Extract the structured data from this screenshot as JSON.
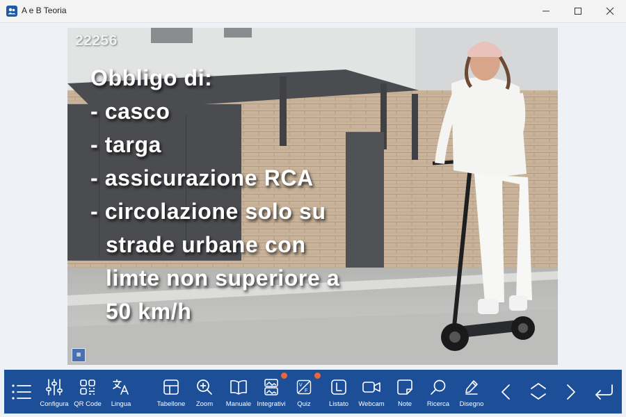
{
  "window": {
    "title": "A e B Teoria"
  },
  "question": {
    "number": "22256",
    "lines": [
      "Obbligo di:",
      "- casco",
      "- targa",
      "- assicurazione RCA",
      "- circolazione solo su",
      "strade urbane con",
      "limte non superiore a",
      "50 km/h"
    ]
  },
  "toolbar": {
    "menu": {
      "icon": "list-icon"
    },
    "configura": {
      "label": "Configura",
      "icon": "sliders-icon"
    },
    "qrcode": {
      "label": "QR Code",
      "icon": "qr-code-icon"
    },
    "lingua": {
      "label": "Lingua",
      "icon": "translate-icon"
    },
    "tabellone": {
      "label": "Tabellone",
      "icon": "grid-icon"
    },
    "zoom": {
      "label": "Zoom",
      "icon": "zoom-in-icon"
    },
    "manuale": {
      "label": "Manuale",
      "icon": "book-icon"
    },
    "integrativi": {
      "label": "Integrativi",
      "icon": "images-icon"
    },
    "quiz": {
      "label": "Quiz",
      "icon": "true-false-icon"
    },
    "listato": {
      "label": "Listato",
      "icon": "letter-l-icon"
    },
    "webcam": {
      "label": "Webcam",
      "icon": "camera-icon"
    },
    "note": {
      "label": "Note",
      "icon": "sticky-note-icon"
    },
    "ricerca": {
      "label": "Ricerca",
      "icon": "search-icon"
    },
    "disegno": {
      "label": "Disegno",
      "icon": "pen-icon"
    }
  },
  "colors": {
    "toolbar": "#1c4f97",
    "badge": "#e8673a"
  }
}
